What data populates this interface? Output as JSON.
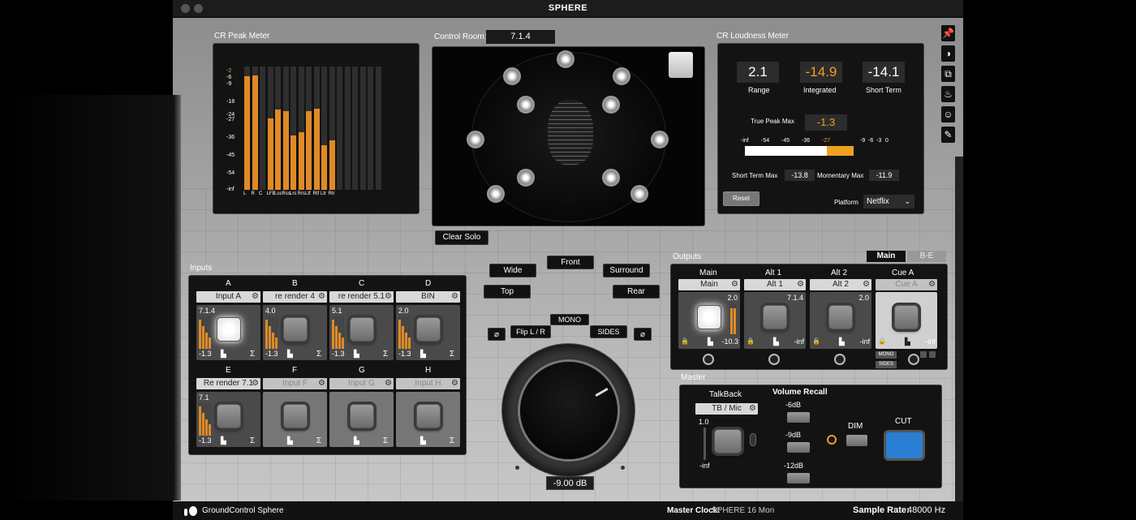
{
  "app": {
    "title": "SPHERE",
    "brand": "GroundControl Sphere",
    "master_clock_label": "Master Clock:",
    "master_clock_value": "SPHERE 16 Mon",
    "sample_rate_label": "Sample Rate:",
    "sample_rate_value": "48000 Hz"
  },
  "peak_meter": {
    "title": "CR Peak Meter",
    "scale": [
      "-2",
      "-6",
      "-9",
      "-18",
      "-24",
      "-27",
      "-36",
      "-45",
      "-54",
      "-inf"
    ],
    "channels": [
      "L",
      "R",
      "C",
      "LFE",
      "Lss",
      "Rss",
      "Lrs",
      "Rrs",
      "Ltf",
      "Rtf",
      "Ltr",
      "Rtr"
    ],
    "levels": [
      0.92,
      0.93,
      0,
      0.58,
      0.65,
      0.64,
      0.44,
      0.47,
      0.64,
      0.66,
      0.36,
      0.4
    ]
  },
  "control_room": {
    "label": "Control Room:",
    "format": "7.1.4",
    "clear_solo": "Clear Solo"
  },
  "loudness": {
    "title": "CR Loudness Meter",
    "range_value": "2.1",
    "range_label": "Range",
    "integrated_value": "-14.9",
    "integrated_label": "Integrated",
    "short_term_value": "-14.1",
    "short_term_label": "Short Term",
    "true_peak_label": "True Peak Max",
    "true_peak_value": "-1.3",
    "scale": [
      "-inf",
      "-54",
      "-45",
      "-36",
      "-27",
      "-9",
      "-6",
      "-3",
      "0"
    ],
    "short_term_max_label": "Short Term Max",
    "short_term_max_value": "-13.8",
    "momentary_max_label": "Momentary Max",
    "momentary_max_value": "-11.9",
    "reset": "Reset",
    "platform_label": "Platform",
    "platform_value": "Netflix",
    "integrated_color": "#f0a020"
  },
  "inputs": {
    "title": "Inputs",
    "slots": [
      {
        "letter": "A",
        "name": "Input A",
        "format": "7.1.4",
        "level": "-1.3"
      },
      {
        "letter": "B",
        "name": "re render 4",
        "format": "4.0",
        "level": "-1.3"
      },
      {
        "letter": "C",
        "name": "re render 5.1",
        "format": "5.1",
        "level": "-1.3"
      },
      {
        "letter": "D",
        "name": "BIN",
        "format": "2.0",
        "level": "-1.3"
      },
      {
        "letter": "E",
        "name": "Re render 7.1",
        "format": "7.1",
        "level": "-1.3"
      },
      {
        "letter": "F",
        "name": "Input F"
      },
      {
        "letter": "G",
        "name": "Input G"
      },
      {
        "letter": "H",
        "name": "Input H"
      }
    ]
  },
  "monitor": {
    "front": "Front",
    "wide": "Wide",
    "surround": "Surround",
    "top": "Top",
    "rear": "Rear",
    "mono": "MONO",
    "flip": "Flip L / R",
    "sides": "SIDES",
    "volume": "-9.00 dB"
  },
  "outputs": {
    "title": "Outputs",
    "tab_main": "Main",
    "tab_be": "B-E",
    "slots": [
      {
        "title": "Main",
        "name": "Main",
        "format": "2.0",
        "level": "-10.3"
      },
      {
        "title": "Alt 1",
        "name": "Alt 1",
        "format": "7.1.4",
        "level": "-inf"
      },
      {
        "title": "Alt 2",
        "name": "Alt 2",
        "format": "2.0",
        "level": "-inf"
      },
      {
        "title": "Cue A",
        "name": "Cue A",
        "level": "-inf",
        "mono": "MONO",
        "sides": "SIDES"
      }
    ]
  },
  "master": {
    "title": "Master",
    "talkback": "TalkBack",
    "tb_select": "TB / Mic",
    "tb_level": "1.0",
    "tb_min": "-inf",
    "volume_recall": "Volume Recall",
    "recall": [
      "-6dB",
      "-9dB",
      "-12dB"
    ],
    "dim": "DIM",
    "cut": "CUT",
    "cut_color": "#2a7fd4"
  },
  "sidebar": {
    "icons": [
      "pin-icon",
      "contrast-icon",
      "layers-icon",
      "flame-icon",
      "smiley-icon",
      "brush-icon"
    ]
  }
}
